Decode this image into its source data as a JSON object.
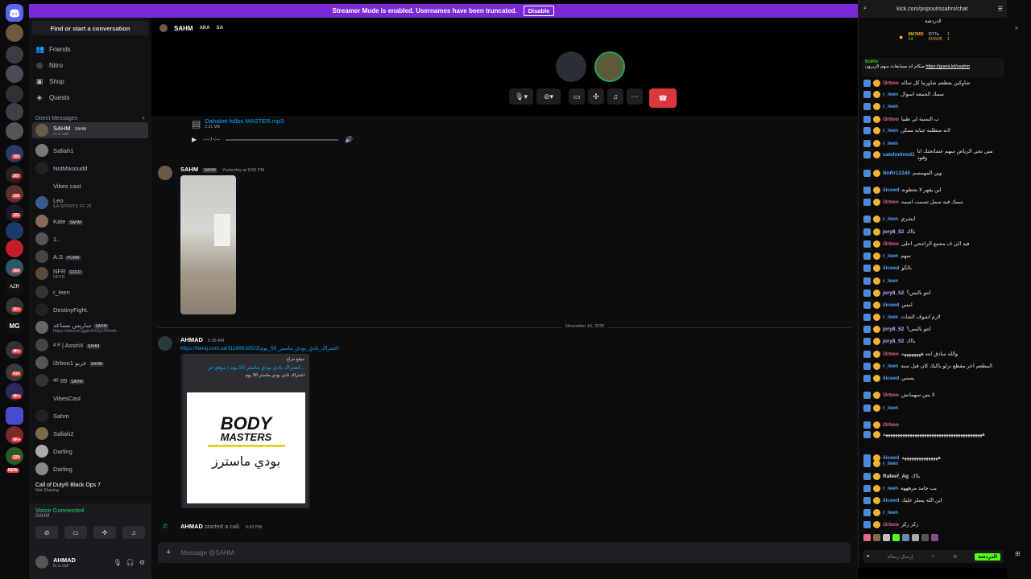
{
  "banner": {
    "text": "Streamer Mode is enabled. Usernames have been truncated.",
    "button": "Disable"
  },
  "sidebar": {
    "find": "Find or start a conversation",
    "nav": [
      {
        "label": "Friends",
        "icon": "friends-icon"
      },
      {
        "label": "Nitro",
        "icon": "nitro-icon"
      },
      {
        "label": "Shop",
        "icon": "shop-icon"
      },
      {
        "label": "Quests",
        "icon": "quests-icon"
      }
    ],
    "dm_header": "Direct Messages",
    "dm_add": "+",
    "dms": [
      {
        "name": "SAHM",
        "tag": "SAHM",
        "sub": "In a call"
      },
      {
        "name": "Safiah1",
        "tag": "",
        "sub": ""
      },
      {
        "name": "NotMasoudd",
        "tag": "",
        "sub": ""
      },
      {
        "name": "Vibes cast",
        "tag": "",
        "sub": ""
      },
      {
        "name": "Leo",
        "tag": "",
        "sub": "EA SPORTS FC 26"
      },
      {
        "name": "Kate",
        "tag": "SAHM",
        "sub": ""
      },
      {
        "name": "1..",
        "tag": "",
        "sub": ""
      },
      {
        "name": "A.S",
        "tag": "POWR",
        "sub": ""
      },
      {
        "name": "NFR",
        "tag": "GOLD",
        "sub": "NFFR"
      },
      {
        "name": "r_leen",
        "tag": "",
        "sub": ""
      },
      {
        "name": "DestinyFight.",
        "tag": "",
        "sub": ""
      },
      {
        "name": "ساريس مساعد",
        "tag": "SAHM",
        "sub": "https://discord.gg/eRX2yUNSwb"
      },
      {
        "name": "ᴬ ᴿ | AssiriX",
        "tag": "SAHM",
        "sub": ""
      },
      {
        "name": "i3rboo1 عربو",
        "tag": "SAHM",
        "sub": ""
      },
      {
        "name": "ᴬᴿ 89",
        "tag": "SAHM",
        "sub": ""
      },
      {
        "name": "VibesCast",
        "tag": "",
        "sub": ""
      },
      {
        "name": "Sahm",
        "tag": "",
        "sub": ""
      },
      {
        "name": "Safiah2",
        "tag": "",
        "sub": ""
      },
      {
        "name": "Darling",
        "tag": "",
        "sub": ""
      },
      {
        "name": "Darling",
        "tag": "",
        "sub": ""
      }
    ],
    "game": {
      "title": "Call of Duty® Black Ops 7",
      "sub": "Not Sharing"
    },
    "voice": {
      "title": "Voice Connected",
      "sub": "SAHM"
    },
    "user": {
      "name": "AHMAD",
      "status": "In a call"
    }
  },
  "rail": {
    "badges": [
      "169",
      "207",
      "160",
      "101",
      "304",
      "1K+",
      "4K+",
      "414",
      "4K+",
      "6K+",
      "229"
    ],
    "labels": [
      "AZR",
      "MG",
      "NEW"
    ]
  },
  "call": {
    "name": "SAHM",
    "aka": "AKA",
    "sa": "SA"
  },
  "messages": {
    "file": {
      "name": "Dahabet follos MASTER.mp3",
      "size": "2.31 MB",
      "time": "-:-- / -:--"
    },
    "m1": {
      "name": "SAHM",
      "tag": "SAHM",
      "time": "Yesterday at 9:55 PM"
    },
    "divider": "November 16, 2025",
    "m2": {
      "name": "AHMAD",
      "time": "6:58 AM",
      "link": "https://haraj.com.sa/11169818523/اشتراك_نادي_بودي_ماستر_50_يوم/",
      "embed_site": "موقع حراج",
      "embed_title": "اشتراك نادي بودي ماستر 50 يوم | موقع حر...",
      "embed_desc": "اشتراك نادي بودي ماستر 50 يوم",
      "logo_top": "BODY",
      "logo_mid": "MASTERS",
      "logo_ar": "بودي ماسترز"
    },
    "m3": {
      "name": "AHMAD",
      "action": "started a call.",
      "time": "9:43 PM"
    }
  },
  "input": {
    "placeholder": "Message @SAHM"
  },
  "kick": {
    "url": "kick.com/popout/ssahm/chat",
    "title": "الدردشة",
    "stats": {
      "a": "8M7MD",
      "b": "D77e",
      "c": "FDS06",
      "d": "14",
      "e": "1",
      "f": "1"
    },
    "pinned_user": "BotRix",
    "pinned_text": "ميكام اند مسابقات سهم الزيرون",
    "pinned_link": "https://gueni.lol/ssahm",
    "lines": [
      {
        "u": "i3rboo",
        "c": "#e8658b",
        "t": "شاوكين بعطعم شاورما كل ساله"
      },
      {
        "u": "r_leen",
        "c": "#56a8ff",
        "t": "سمك الجمعه اسوال"
      },
      {
        "u": "r_leen",
        "c": "#56a8ff",
        "t": ""
      },
      {
        "u": "i3rboo",
        "c": "#e8658b",
        "t": "ب النسبة لي طيبا"
      },
      {
        "u": "r_leen",
        "c": "#56a8ff",
        "t": "لانه متطلبه جبايه ممكن"
      },
      {
        "u": "r_leen",
        "c": "#56a8ff",
        "t": ""
      },
      {
        "u": "salehmhmd1",
        "c": "#56a8ff",
        "t": "متى تجي الرياض سهم عشانجتك انا وقود"
      },
      {
        "u": "NnRr12345",
        "c": "#56a8ff",
        "t": "وين المهمسم"
      },
      {
        "u": "iiiceed",
        "c": "#56a8ff",
        "t": "اين يفهر لا تحطونه"
      },
      {
        "u": "i3rboo",
        "c": "#e8658b",
        "t": "سمك فيه سمل تسمت اسمه"
      },
      {
        "u": "r_leen",
        "c": "#56a8ff",
        "t": "ابشري"
      },
      {
        "u": "jory8_52",
        "c": "#c7a8ff",
        "t": "بااك"
      },
      {
        "u": "i3rboo",
        "c": "#e8658b",
        "t": "فيه الي ف مجمع الراجحي احلى"
      },
      {
        "u": "r_leen",
        "c": "#56a8ff",
        "t": "سهم"
      },
      {
        "u": "iiiceed",
        "c": "#56a8ff",
        "t": "بالكو"
      },
      {
        "u": "r_leen",
        "c": "#56a8ff",
        "t": ""
      },
      {
        "u": "jory8_52",
        "c": "#c7a8ff",
        "t": "انتو بالبس؟"
      },
      {
        "u": "iiiceed",
        "c": "#56a8ff",
        "t": "امس"
      },
      {
        "u": "r_leen",
        "c": "#56a8ff",
        "t": "لازم اشوف الشات"
      },
      {
        "u": "jory8_52",
        "c": "#c7a8ff",
        "t": "انتو بالبس؟"
      },
      {
        "u": "jory8_52",
        "c": "#c7a8ff",
        "t": "بااك"
      },
      {
        "u": "i3rboo",
        "c": "#e8658b",
        "t": "والله سادق انته ههههههههه"
      },
      {
        "u": "r_leen",
        "c": "#56a8ff",
        "t": "المطعم اخر مقطع نزلو باكيك كان قبل سنه"
      },
      {
        "u": "iiiceed",
        "c": "#56a8ff",
        "t": "بسس"
      },
      {
        "u": "i3rboo",
        "c": "#e8658b",
        "t": "لا بس سهمانش"
      },
      {
        "u": "r_leen",
        "c": "#56a8ff",
        "t": ""
      },
      {
        "u": "i3rboo",
        "c": "#e8658b",
        "t": ""
      },
      {
        "u": "",
        "c": "#e5e5e5",
        "t": "هههههههههههههههههههههههههههههههههههههههههه"
      },
      {
        "u": "iiiceed",
        "c": "#56a8ff",
        "t": "هههههههههههههههه"
      },
      {
        "u": "r_leen",
        "c": "#56a8ff",
        "t": ""
      },
      {
        "u": "Rafeef_Ag",
        "c": "#dbdee1",
        "t": "بااك"
      },
      {
        "u": "r_leen",
        "c": "#56a8ff",
        "t": "يب جامد مرهههه"
      },
      {
        "u": "iiiceed",
        "c": "#56a8ff",
        "t": "اين الله يسلر عليك"
      },
      {
        "u": "r_leen",
        "c": "#56a8ff",
        "t": ""
      },
      {
        "u": "i3rboo",
        "c": "#e8658b",
        "t": "ركز ركز"
      }
    ],
    "input_placeholder": "إرسال رسالة",
    "send": "الدردشة"
  }
}
